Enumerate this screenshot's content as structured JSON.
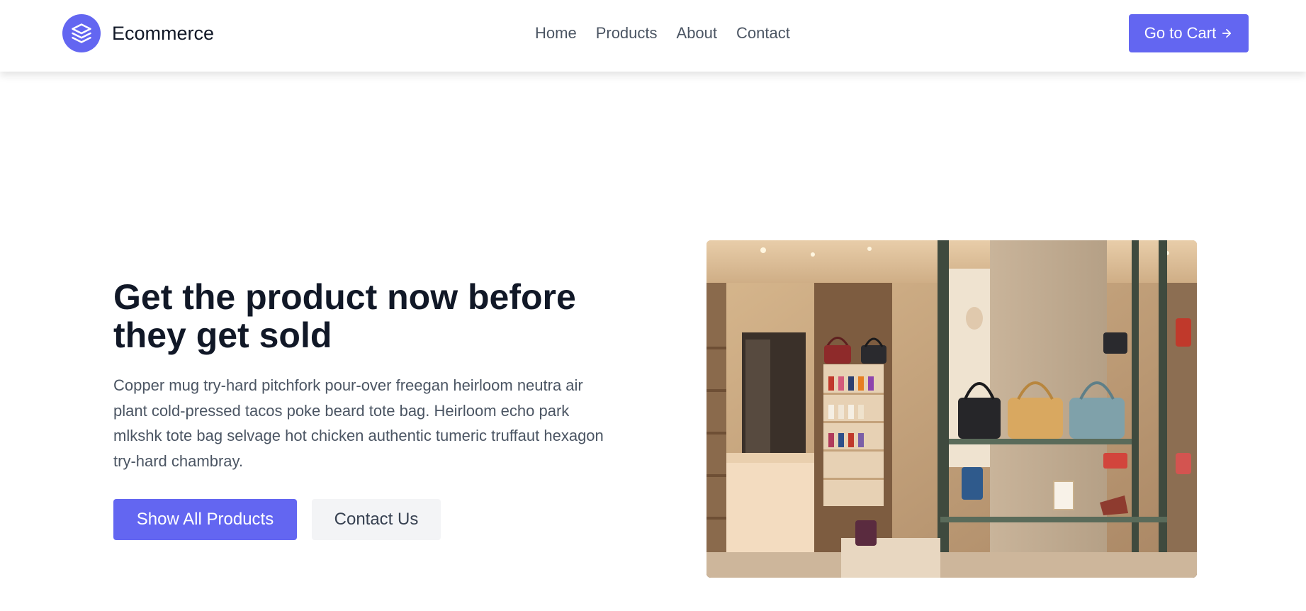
{
  "header": {
    "brand_name": "Ecommerce",
    "logo_icon": "layers-icon",
    "nav": [
      {
        "label": "Home"
      },
      {
        "label": "Products"
      },
      {
        "label": "About"
      },
      {
        "label": "Contact"
      }
    ],
    "cart_button_label": "Go to Cart",
    "cart_button_icon": "arrow-right-icon"
  },
  "hero": {
    "title": "Get the product now before they get sold",
    "description": "Copper mug try-hard pitchfork pour-over freegan heirloom neutra air plant cold-pressed tacos poke beard tote bag. Heirloom echo park mlkshk tote bag selvage hot chicken authentic tumeric truffaut hexagon try-hard chambray.",
    "primary_button": "Show All Products",
    "secondary_button": "Contact Us",
    "image_subject": "boutique store interior with handbags and shoes on shelves"
  },
  "colors": {
    "accent": "#6366f1",
    "heading": "#111827",
    "body_text": "#4b5563",
    "secondary_button_bg": "#f3f4f6"
  }
}
